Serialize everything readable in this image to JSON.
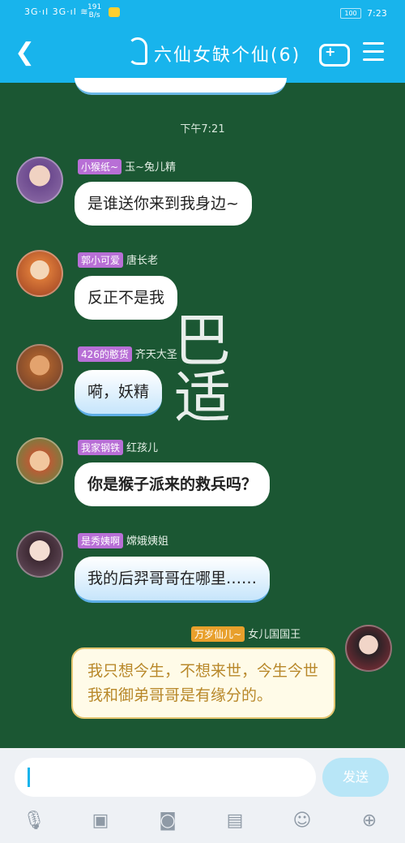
{
  "statusbar": {
    "signal": "3G‧ıl 3G‧ıl ≋",
    "speed_top": "191",
    "speed_unit": "B/s",
    "battery": "100",
    "time": "7:23"
  },
  "header": {
    "back_icon": "back-arrow",
    "title": "六仙女缺个仙(6)"
  },
  "timestamp": "下午7:21",
  "messages": [
    {
      "tag": "小猴纸~",
      "name": "玉~兔儿精",
      "text": "是谁送你来到我身边~"
    },
    {
      "tag": "郭小可爱",
      "name": "唐长老",
      "text": "反正不是我"
    },
    {
      "tag": "426的憨货",
      "name": "齐天大圣",
      "text": "嗬，妖精"
    },
    {
      "tag": "我家钢铁",
      "name": "红孩儿",
      "text": "你是猴子派来的救兵吗？"
    },
    {
      "tag": "是秀姨啊",
      "name": "嫦娥姨姐",
      "text": "我的后羿哥哥在哪里……"
    },
    {
      "tag": "万岁仙儿~",
      "name": "女儿国国王",
      "text": "我只想今生，不想来世，今生今世我和御弟哥哥是有缘分的。"
    }
  ],
  "watermark": "巴适",
  "input": {
    "placeholder": "",
    "send": "发送"
  },
  "toolbar": [
    "mic-icon",
    "image-icon",
    "camera-icon",
    "redpacket-icon",
    "emoji-icon",
    "plus-icon"
  ]
}
